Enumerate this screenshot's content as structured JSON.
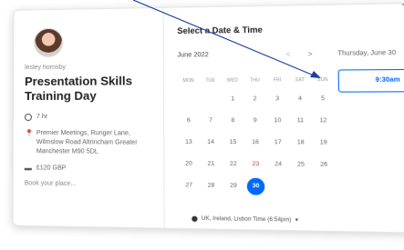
{
  "host": {
    "name": "lesley hornsby"
  },
  "event": {
    "title_line1": "Presentation Skills",
    "title_line2": "Training Day",
    "duration": "7 hr",
    "location": "Premier Meetings, Runger Lane, Wilmslow Road Altrincham Greater Manchester M90 5DL",
    "price": "£120 GBP",
    "book_text": "Book your place..."
  },
  "calendar": {
    "title": "Select a Date & Time",
    "month": "June 2022",
    "prev": "<",
    "next": ">",
    "weekdays": [
      "MON",
      "TUE",
      "WED",
      "THU",
      "FRI",
      "SAT",
      "SUN"
    ],
    "days": [
      {
        "label": "",
        "state": "empty"
      },
      {
        "label": "",
        "state": "empty"
      },
      {
        "label": "1",
        "state": "off"
      },
      {
        "label": "2",
        "state": "off"
      },
      {
        "label": "3",
        "state": "off"
      },
      {
        "label": "4",
        "state": "off"
      },
      {
        "label": "5",
        "state": "off"
      },
      {
        "label": "6",
        "state": "off"
      },
      {
        "label": "7",
        "state": "off"
      },
      {
        "label": "8",
        "state": "off"
      },
      {
        "label": "9",
        "state": "off"
      },
      {
        "label": "10",
        "state": "off"
      },
      {
        "label": "11",
        "state": "off"
      },
      {
        "label": "12",
        "state": "off"
      },
      {
        "label": "13",
        "state": "off"
      },
      {
        "label": "14",
        "state": "off"
      },
      {
        "label": "15",
        "state": "off"
      },
      {
        "label": "16",
        "state": "off"
      },
      {
        "label": "17",
        "state": "off"
      },
      {
        "label": "18",
        "state": "off"
      },
      {
        "label": "19",
        "state": "off"
      },
      {
        "label": "20",
        "state": "off"
      },
      {
        "label": "21",
        "state": "off"
      },
      {
        "label": "22",
        "state": "off"
      },
      {
        "label": "23",
        "state": "red"
      },
      {
        "label": "24",
        "state": "off"
      },
      {
        "label": "25",
        "state": "off"
      },
      {
        "label": "26",
        "state": "off"
      },
      {
        "label": "27",
        "state": "off"
      },
      {
        "label": "28",
        "state": "off"
      },
      {
        "label": "29",
        "state": "off"
      },
      {
        "label": "30",
        "state": "selected"
      }
    ],
    "timezone": "UK, Ireland, Lisbon Time (6:54pm)"
  },
  "times": {
    "date_label": "Thursday, June 30",
    "slots": [
      "9:30am"
    ]
  }
}
